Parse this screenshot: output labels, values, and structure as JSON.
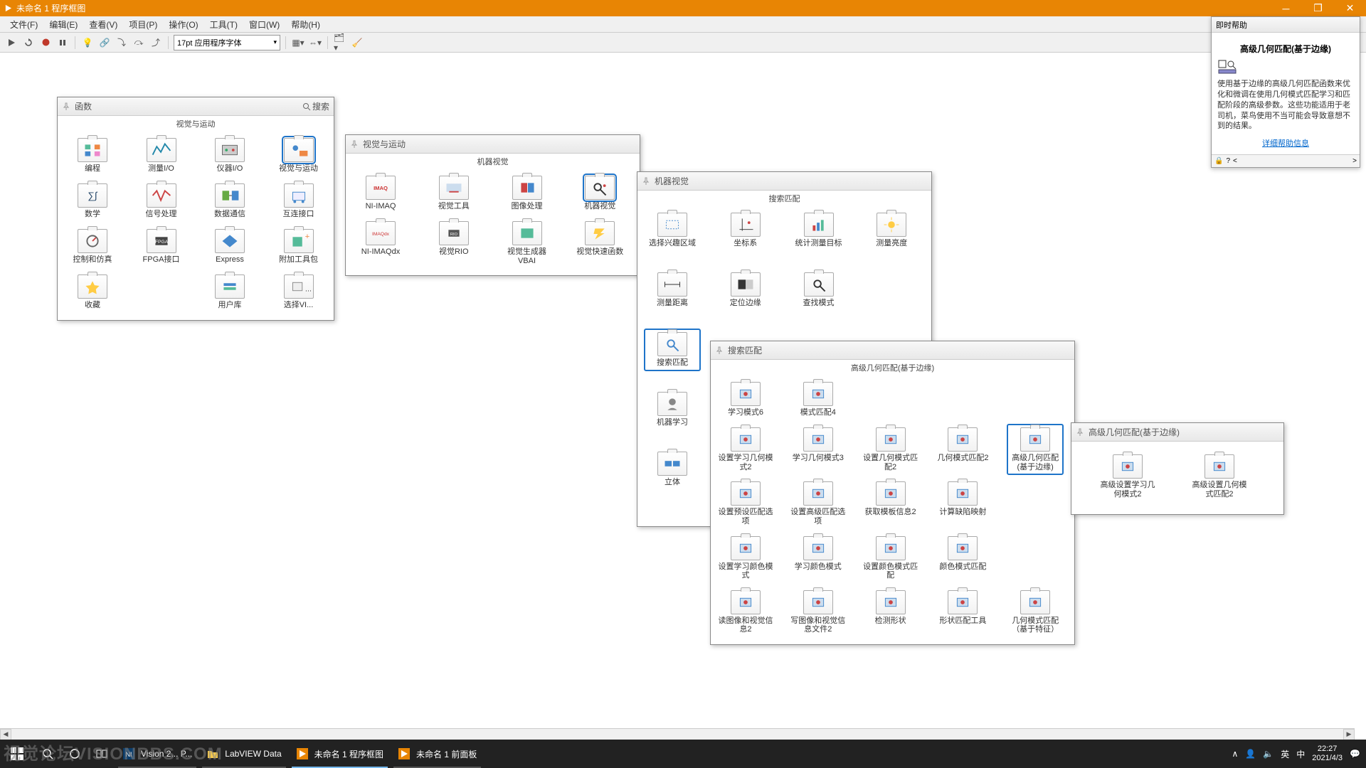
{
  "window": {
    "title": "未命名 1 程序框图"
  },
  "menu": {
    "file": "文件(F)",
    "edit": "编辑(E)",
    "view": "查看(V)",
    "project": "项目(P)",
    "operate": "操作(O)",
    "tools": "工具(T)",
    "window": "窗口(W)",
    "help": "帮助(H)"
  },
  "toolbar": {
    "font": "17pt 应用程序字体"
  },
  "palette_functions": {
    "title": "函数",
    "search": "搜索",
    "subtitle": "视觉与运动",
    "items": [
      {
        "label": "编程",
        "icon": "prog"
      },
      {
        "label": "测量I/O",
        "icon": "meas"
      },
      {
        "label": "仪器I/O",
        "icon": "instr"
      },
      {
        "label": "视觉与运动",
        "icon": "vision",
        "selected": true
      },
      {
        "label": "数学",
        "icon": "math"
      },
      {
        "label": "信号处理",
        "icon": "signal"
      },
      {
        "label": "数据通信",
        "icon": "data"
      },
      {
        "label": "互连接口",
        "icon": "inter"
      },
      {
        "label": "控制和仿真",
        "icon": "ctrl"
      },
      {
        "label": "FPGA接口",
        "icon": "fpga"
      },
      {
        "label": "Express",
        "icon": "expr"
      },
      {
        "label": "附加工具包",
        "icon": "addon"
      },
      {
        "label": "收藏",
        "icon": "fav"
      },
      {
        "label": "",
        "icon": ""
      },
      {
        "label": "用户库",
        "icon": "user"
      },
      {
        "label": "选择VI...",
        "icon": "sel"
      }
    ]
  },
  "palette_vision": {
    "title": "视觉与运动",
    "subtitle": "机器视觉",
    "items": [
      {
        "label": "NI-IMAQ",
        "icon": "imaq"
      },
      {
        "label": "视觉工具",
        "icon": "vtool"
      },
      {
        "label": "图像处理",
        "icon": "imgproc"
      },
      {
        "label": "机器视觉",
        "icon": "mv",
        "selected": true
      },
      {
        "label": "NI-IMAQdx",
        "icon": "imaqdx"
      },
      {
        "label": "视觉RIO",
        "icon": "vrio"
      },
      {
        "label": "视觉生成器VBAI",
        "icon": "vbai"
      },
      {
        "label": "视觉快速函数",
        "icon": "vfast"
      }
    ]
  },
  "palette_mv": {
    "title": "机器视觉",
    "subtitle": "搜索匹配",
    "items": [
      {
        "label": "选择兴趣区域",
        "icon": "roi"
      },
      {
        "label": "坐标系",
        "icon": "coord"
      },
      {
        "label": "统计测量目标",
        "icon": "stat"
      },
      {
        "label": "测量亮度",
        "icon": "bright"
      },
      {
        "label": "测量距离",
        "icon": "dist"
      },
      {
        "label": "定位边缘",
        "icon": "edge"
      },
      {
        "label": "查找模式",
        "icon": "find"
      },
      {
        "label": "",
        "icon": ""
      },
      {
        "label": "搜索匹配",
        "icon": "search",
        "selected": true
      },
      {
        "label": "",
        "icon": ""
      },
      {
        "label": "",
        "icon": ""
      },
      {
        "label": "",
        "icon": ""
      },
      {
        "label": "机器学习",
        "icon": "ml"
      },
      {
        "label": "",
        "icon": ""
      },
      {
        "label": "",
        "icon": ""
      },
      {
        "label": "",
        "icon": ""
      },
      {
        "label": "立体",
        "icon": "stereo"
      }
    ]
  },
  "palette_search": {
    "title": "搜索匹配",
    "subtitle": "高级几何匹配(基于边缘)",
    "items": [
      {
        "label": "学习模式6",
        "icon": "lm6"
      },
      {
        "label": "模式匹配4",
        "icon": "pm4"
      },
      {
        "label": "",
        "icon": ""
      },
      {
        "label": "",
        "icon": ""
      },
      {
        "label": "",
        "icon": ""
      },
      {
        "label": "设置学习几何模式2",
        "icon": "slgm2"
      },
      {
        "label": "学习几何模式3",
        "icon": "lgm3"
      },
      {
        "label": "设置几何模式匹配2",
        "icon": "sgmm2"
      },
      {
        "label": "几何模式匹配2",
        "icon": "gmm2"
      },
      {
        "label": "高级几何匹配(基于边缘)",
        "icon": "agme",
        "selected": true
      },
      {
        "label": "设置预设匹配选项",
        "icon": "spmo"
      },
      {
        "label": "设置高级匹配选项",
        "icon": "samo"
      },
      {
        "label": "获取模板信息2",
        "icon": "gti2"
      },
      {
        "label": "计算缺陷映射",
        "icon": "cdm"
      },
      {
        "label": "",
        "icon": ""
      },
      {
        "label": "设置学习颜色模式",
        "icon": "slcm"
      },
      {
        "label": "学习颜色模式",
        "icon": "lcm"
      },
      {
        "label": "设置颜色模式匹配",
        "icon": "scmm"
      },
      {
        "label": "颜色模式匹配",
        "icon": "cmm"
      },
      {
        "label": "",
        "icon": ""
      },
      {
        "label": "读图像和视觉信息2",
        "icon": "rivi2"
      },
      {
        "label": "写图像和视觉信息文件2",
        "icon": "wivif2"
      },
      {
        "label": "检测形状",
        "icon": "ds"
      },
      {
        "label": "形状匹配工具",
        "icon": "smt"
      },
      {
        "label": "几何模式匹配（基于特征）",
        "icon": "gmmf"
      }
    ]
  },
  "palette_agme": {
    "title": "高级几何匹配(基于边缘)",
    "items": [
      {
        "label": "高级设置学习几何模式2",
        "icon": "aslgm2"
      },
      {
        "label": "高级设置几何模式匹配2",
        "icon": "asgmm2"
      }
    ]
  },
  "help": {
    "title": "即时帮助",
    "func": "高级几何匹配(基于边缘)",
    "desc": "使用基于边缘的高级几何匹配函数来优化和微调在使用几何模式匹配学习和匹配阶段的高级参数。这些功能适用于老司机，菜鸟使用不当可能会导致意想不到的结果。",
    "link": "详细帮助信息"
  },
  "taskbar": {
    "items": [
      {
        "label": "",
        "icon": "search",
        "active": false,
        "kind": "search"
      },
      {
        "label": "",
        "icon": "cortana",
        "active": false,
        "kind": "circle"
      },
      {
        "label": "",
        "icon": "taskview",
        "active": false,
        "kind": "taskview"
      },
      {
        "label": "Vision 2... P...",
        "icon": "ni",
        "active": false,
        "running": true,
        "kind": "ni"
      },
      {
        "label": "LabVIEW Data",
        "icon": "folder",
        "active": false,
        "running": true,
        "kind": "folder"
      },
      {
        "label": "未命名 1 程序框图",
        "icon": "lv",
        "active": true,
        "kind": "lv"
      },
      {
        "label": "未命名 1 前面板",
        "icon": "lv",
        "active": false,
        "running": true,
        "kind": "lv"
      }
    ],
    "tray": {
      "expand": "∧",
      "people": "👤",
      "net": "🔈",
      "ime1": "英",
      "ime2": "中"
    },
    "clock": {
      "time": "22:27",
      "date": "2021/4/3"
    }
  },
  "watermark": "视觉论坛VISIONBBS.COM"
}
